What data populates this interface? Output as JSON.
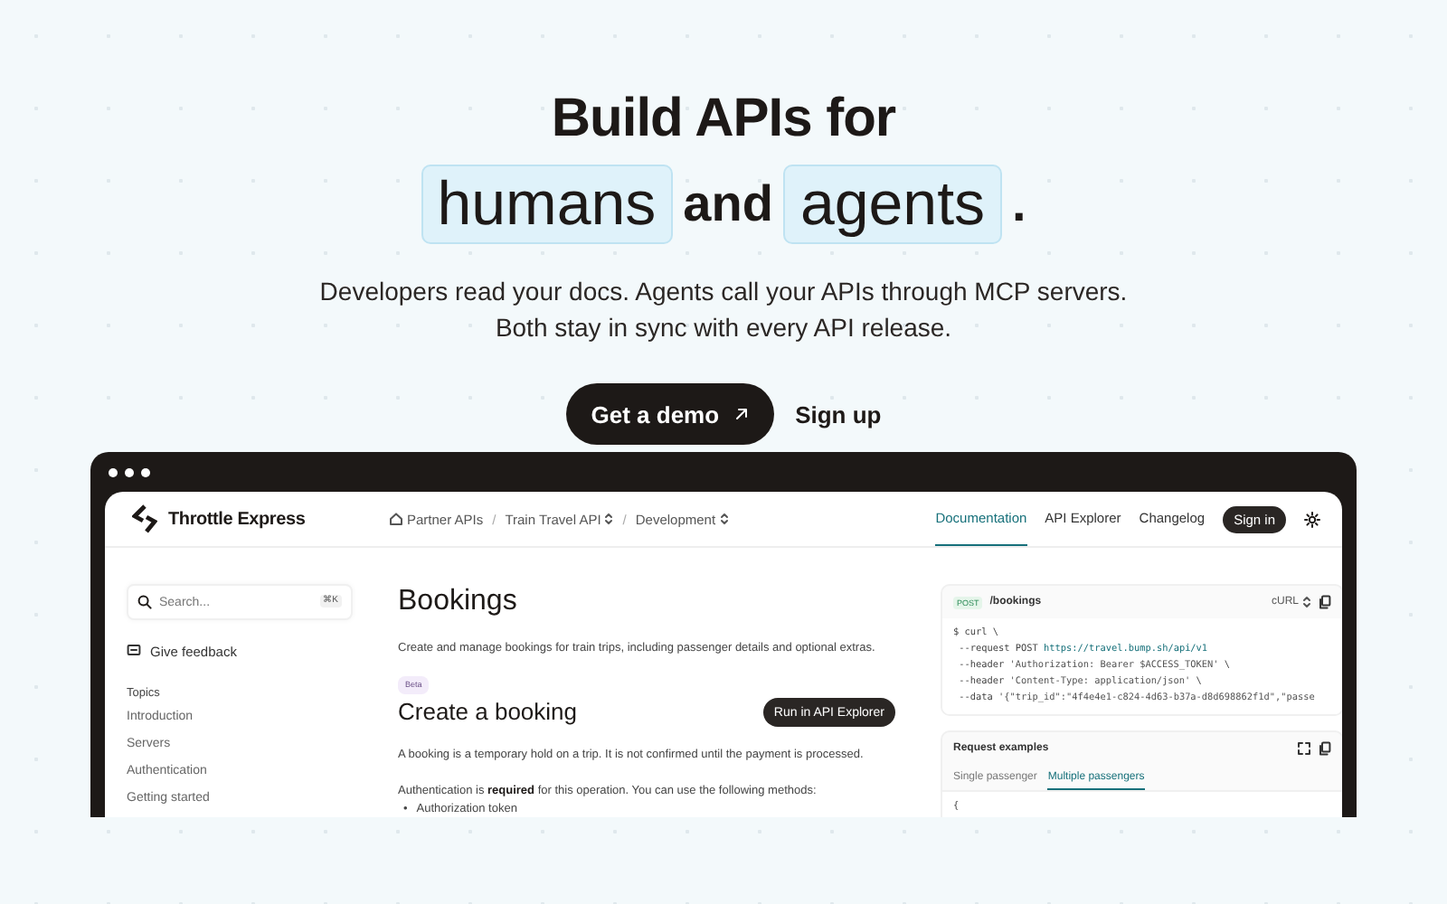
{
  "hero": {
    "title": "Build APIs for",
    "title_words": [
      {
        "text": "humans",
        "kind": "highlight"
      },
      {
        "text": "and",
        "kind": "plain"
      },
      {
        "text": "agents",
        "kind": "highlight"
      },
      {
        "text": ".",
        "kind": "plain"
      }
    ],
    "subtitle": [
      "Developers read your docs. Agents call your APIs through MCP servers.",
      "Both stay in sync with every API release."
    ],
    "buttons": [
      {
        "label": "Get a demo",
        "kind": "primary"
      },
      {
        "label": "Sign up",
        "kind": "link"
      }
    ]
  },
  "app": {
    "brand": "Throttle Express",
    "breadcrumb_separator": "/",
    "breadcrumbs": [
      {
        "label": "Partner APIs",
        "switcher": false
      },
      {
        "label": "Train Travel API",
        "switcher": true
      },
      {
        "label": "Development",
        "switcher": true
      }
    ],
    "nav": [
      {
        "label": "Documentation",
        "selected": true
      },
      {
        "label": "API Explorer",
        "selected": false
      },
      {
        "label": "Changelog",
        "selected": false
      }
    ],
    "sign_in": "Sign in",
    "sidebar": {
      "search": {
        "placeholder": "Search...",
        "shortcut": "⌘K"
      },
      "feedback": "Give feedback",
      "heading": "Topics",
      "items": [
        "Introduction",
        "Servers",
        "Authentication",
        "Getting started"
      ]
    },
    "main": {
      "title": "Bookings",
      "description": "Create and manage bookings for train trips, including passenger details and optional extras.",
      "badge": "Beta",
      "heading": "Create a booking",
      "run_button": "Run in API Explorer",
      "paragraph": "A booking is a temporary hold on a trip. It is not confirmed until the payment is processed.",
      "auth": "Authentication is **required** for this operation. You can use the following methods:",
      "bullets": [
        {
          "marker": "•",
          "text": "Authorization token"
        }
      ]
    },
    "code_card": {
      "method": "POST",
      "path": "/bookings",
      "language": "cURL",
      "lines": [
        [
          {
            "text": "$ curl \\",
            "kind": "plain"
          }
        ],
        [
          {
            "text": " --request POST ",
            "kind": "plain"
          },
          {
            "text": "https://travel.bump.sh/api/v1",
            "kind": "url"
          }
        ],
        [
          {
            "text": " --header ",
            "kind": "plain"
          },
          {
            "text": "'Authorization: Bearer $ACCESS_TOKEN'",
            "kind": "string"
          },
          {
            "text": " \\",
            "kind": "plain"
          }
        ],
        [
          {
            "text": " --header ",
            "kind": "plain"
          },
          {
            "text": "'Content-Type: application/json'",
            "kind": "string"
          },
          {
            "text": " \\",
            "kind": "plain"
          }
        ],
        [
          {
            "text": " --data ",
            "kind": "plain"
          },
          {
            "text": "'{\"trip_id\":\"4f4e4e1-c824-4d63-b37a-d8d698862f1d\",\"passe",
            "kind": "string"
          }
        ]
      ]
    },
    "examples": {
      "title": "Request examples",
      "tabs": [
        {
          "label": "Single passenger",
          "selected": false
        },
        {
          "label": "Multiple passengers",
          "selected": true
        }
      ],
      "code": "{"
    }
  }
}
